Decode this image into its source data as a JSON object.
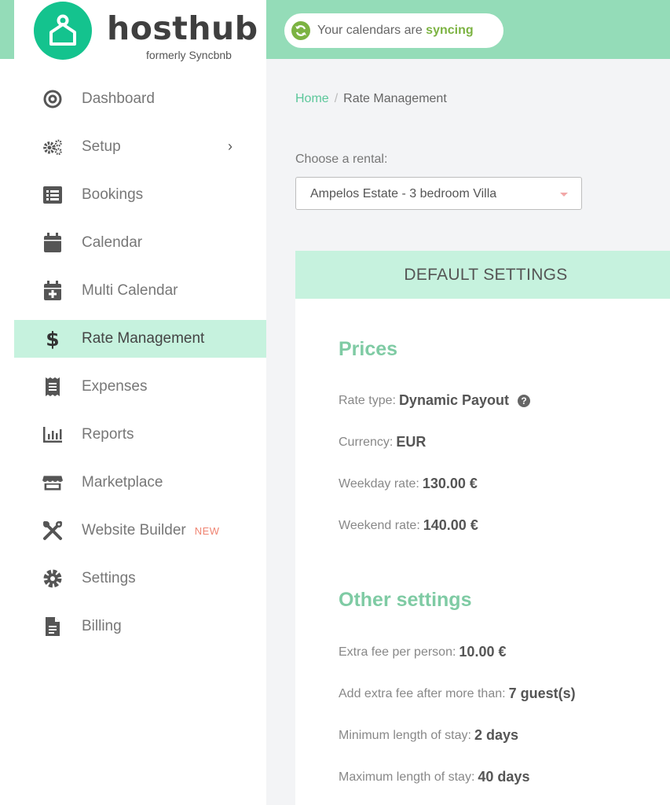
{
  "brand": {
    "name": "hosthub",
    "subtitle": "formerly Syncbnb",
    "logo_icon": "house-person-icon",
    "logo_color": "#14c38e"
  },
  "topbar": {
    "sync_prefix": "Your calendars are",
    "sync_status": "syncing",
    "sync_icon": "refresh-icon",
    "background": "#94dcb8"
  },
  "sidebar": {
    "items": [
      {
        "label": "Dashboard",
        "icon": "target-icon"
      },
      {
        "label": "Setup",
        "icon": "gears-icon",
        "chevron": "›"
      },
      {
        "label": "Bookings",
        "icon": "list-icon"
      },
      {
        "label": "Calendar",
        "icon": "calendar-icon"
      },
      {
        "label": "Multi Calendar",
        "icon": "calendar-plus-icon"
      },
      {
        "label": "Rate Management",
        "icon": "dollar-icon",
        "active": true
      },
      {
        "label": "Expenses",
        "icon": "receipt-icon"
      },
      {
        "label": "Reports",
        "icon": "bar-chart-icon"
      },
      {
        "label": "Marketplace",
        "icon": "store-icon"
      },
      {
        "label": "Website Builder",
        "icon": "tools-icon",
        "badge": "NEW"
      },
      {
        "label": "Settings",
        "icon": "gear-icon"
      },
      {
        "label": "Billing",
        "icon": "document-icon"
      }
    ],
    "active_color": "#c6f2de"
  },
  "breadcrumb": {
    "home": "Home",
    "separator": "/",
    "current": "Rate Management"
  },
  "rental": {
    "label": "Choose a rental:",
    "selected": "Ampelos Estate - 3 bedroom Villa"
  },
  "settings": {
    "header": "DEFAULT SETTINGS",
    "prices": {
      "title": "Prices",
      "rate_type_label": "Rate type:",
      "rate_type_value": "Dynamic Payout",
      "currency_label": "Currency:",
      "currency_value": "EUR",
      "weekday_label": "Weekday rate:",
      "weekday_value": "130.00 €",
      "weekend_label": "Weekend rate:",
      "weekend_value": "140.00 €"
    },
    "other": {
      "title": "Other settings",
      "extra_fee_label": "Extra fee per person:",
      "extra_fee_value": "10.00 €",
      "extra_after_label": "Add extra fee after more than:",
      "extra_after_value": "7 guest(s)",
      "min_stay_label": "Minimum length of stay:",
      "min_stay_value": "2 days",
      "max_stay_label": "Maximum length of stay:",
      "max_stay_value": "40 days"
    },
    "accent_color": "#7fcba4"
  }
}
